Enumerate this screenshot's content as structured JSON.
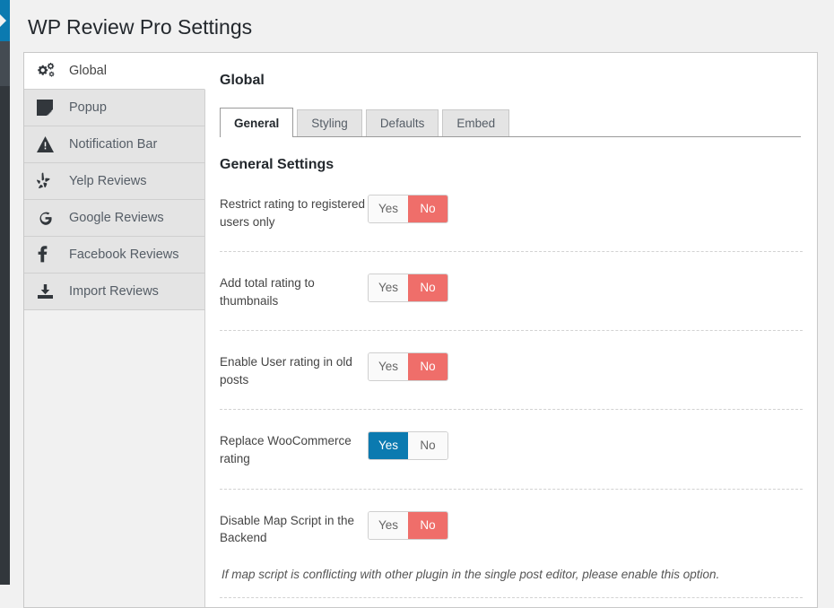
{
  "page": {
    "title": "WP Review Pro Settings"
  },
  "sidebar": {
    "items": [
      {
        "label": "Global",
        "icon": "gears-icon",
        "active": true
      },
      {
        "label": "Popup",
        "icon": "popup-window-icon",
        "active": false
      },
      {
        "label": "Notification Bar",
        "icon": "warning-triangle-icon",
        "active": false
      },
      {
        "label": "Yelp Reviews",
        "icon": "yelp-burst-icon",
        "active": false
      },
      {
        "label": "Google Reviews",
        "icon": "google-g-icon",
        "active": false
      },
      {
        "label": "Facebook Reviews",
        "icon": "facebook-f-icon",
        "active": false
      },
      {
        "label": "Import Reviews",
        "icon": "download-tray-icon",
        "active": false
      }
    ]
  },
  "content": {
    "title": "Global",
    "tabs": [
      {
        "label": "General",
        "active": true
      },
      {
        "label": "Styling",
        "active": false
      },
      {
        "label": "Defaults",
        "active": false
      },
      {
        "label": "Embed",
        "active": false
      }
    ],
    "section_title": "General Settings",
    "toggle_options": {
      "yes": "Yes",
      "no": "No"
    },
    "settings": [
      {
        "label": "Restrict rating to registered users only",
        "value": "No"
      },
      {
        "label": "Add total rating to thumbnails",
        "value": "No"
      },
      {
        "label": "Enable User rating in old posts",
        "value": "No"
      },
      {
        "label": "Replace WooCommerce rating",
        "value": "Yes"
      },
      {
        "label": "Disable Map Script in the Backend",
        "value": "No"
      }
    ],
    "note": "If map script is conflicting with other plugin in the single post editor, please enable this option."
  },
  "colors": {
    "accent_blue": "#0b7ab0",
    "accent_red": "#ef6e6a",
    "page_bg": "#f1f1f1",
    "nav_inactive_bg": "#e4e4e4"
  }
}
